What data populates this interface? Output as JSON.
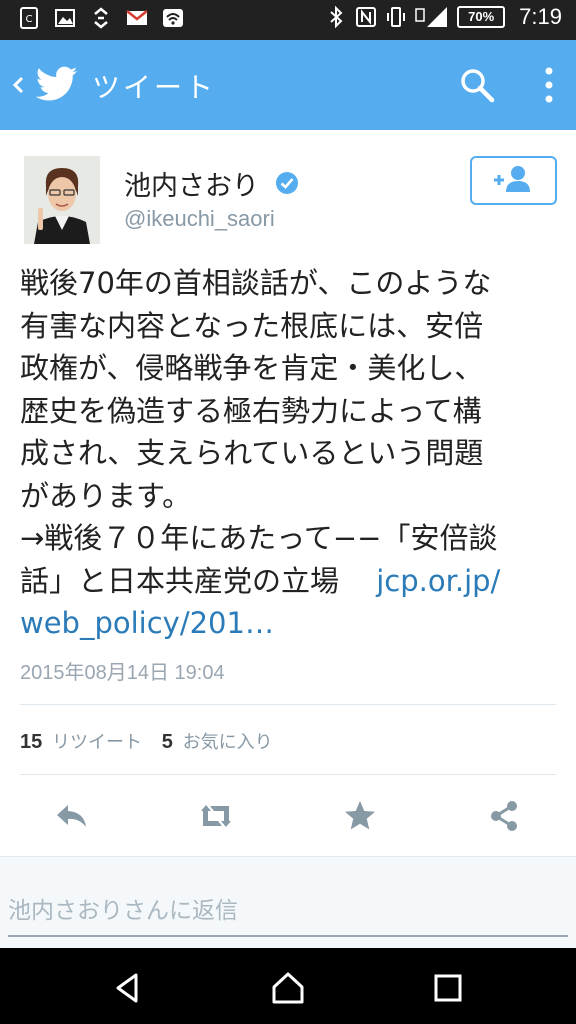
{
  "status_bar": {
    "battery": "70%",
    "time": "7:19"
  },
  "app_bar": {
    "title": "ツイート"
  },
  "tweet": {
    "author_name": "池内さおり",
    "handle": "@ikeuchi_saori",
    "lines": [
      "戦後70年の首相談話が、このような",
      "有害な内容となった根底には、安倍",
      "政権が、侵略戦争を肯定・美化し、",
      "歴史を偽造する極右勢力によって構",
      "成され、支えられているという問題",
      "があります。",
      "→戦後７０年にあたって−−「安倍談"
    ],
    "last_text": "話」と日本共産党の立場",
    "link_part1": "jcp.or.jp/",
    "link_part2": "web_policy/201…",
    "timestamp": "2015年08月14日 19:04"
  },
  "stats": {
    "retweet_count": "15",
    "retweet_label": "リツイート",
    "favorite_count": "5",
    "favorite_label": "お気に入り"
  },
  "reply": {
    "placeholder": "池内さおりさんに返信"
  },
  "colors": {
    "brand": "#55acee",
    "link": "#2b7bb9"
  }
}
